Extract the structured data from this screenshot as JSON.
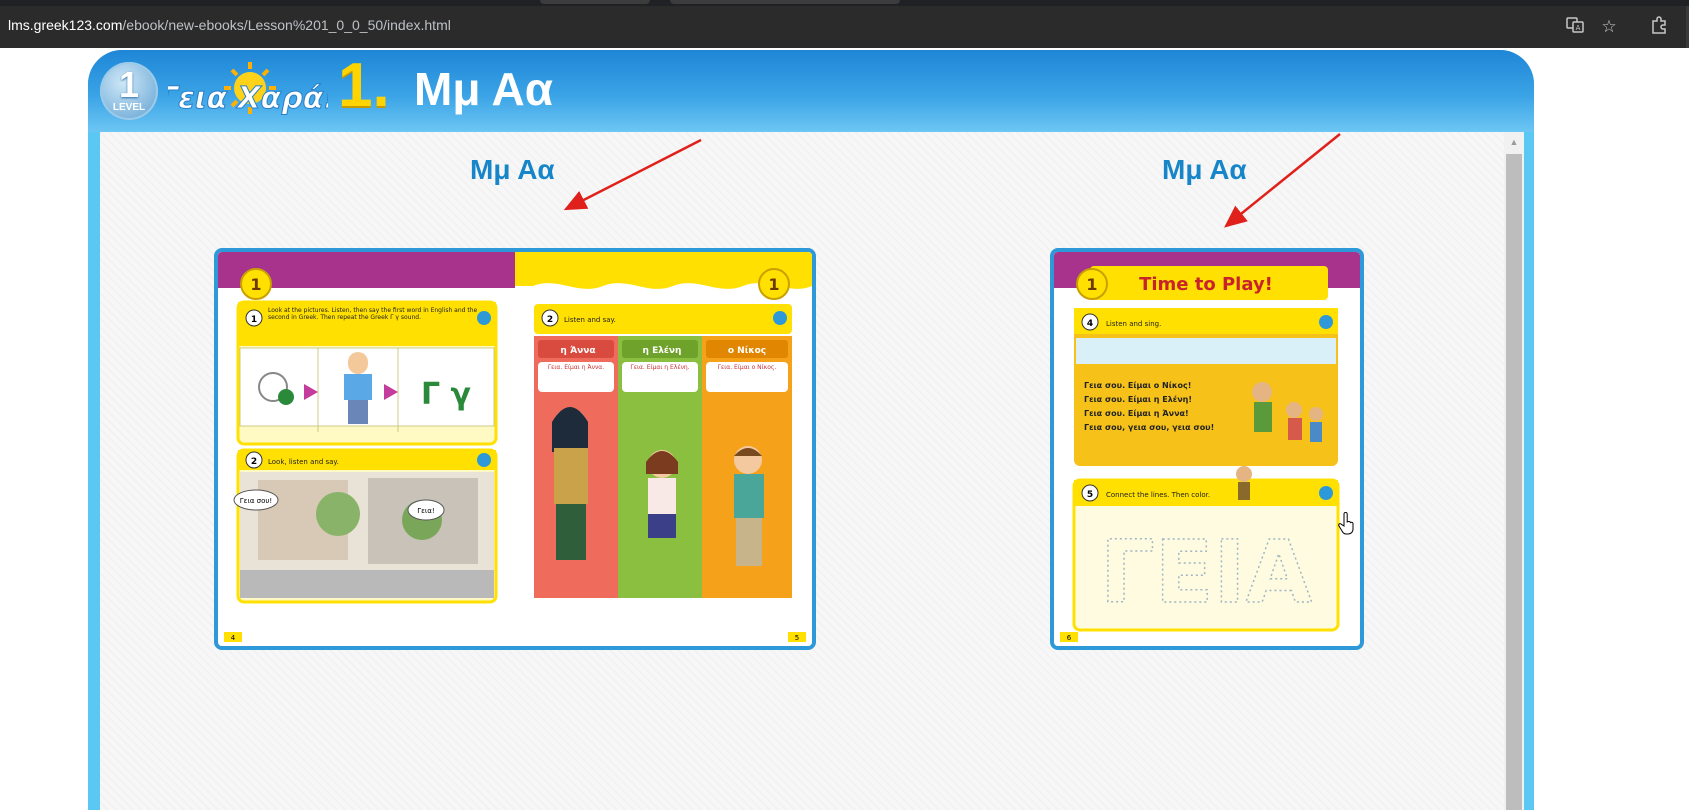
{
  "browser": {
    "url_host": "lms.greek123.com",
    "url_path": "/ebook/new-ebooks/Lesson%201_0_0_50/index.html",
    "icons": [
      "translate-icon",
      "bookmark-star-icon",
      "extensions-icon"
    ]
  },
  "header": {
    "level_number": "1",
    "level_label": "LEVEL",
    "logo_text": "Γεια Χαρά!",
    "lesson_number": "1.",
    "lesson_title": "Μμ Αα"
  },
  "pages": [
    {
      "title": "Μμ Αα",
      "left_page": {
        "lesson_badge": "1",
        "task1": "Look at the pictures. Listen, then say the first word in English and the second in Greek. Then repeat the Greek Γ γ sound.",
        "big_letters": "Γ γ",
        "task2": "Look, listen and say.",
        "bubble_left": "Γεια σου!",
        "bubble_right": "Γεια!",
        "page_no": "4"
      },
      "right_page": {
        "lesson_badge": "1",
        "task": "Listen and say.",
        "names": [
          "η Άννα",
          "η Ελένη",
          "ο Νίκος"
        ],
        "greetings": [
          "Γεια. Είμαι η Άννα.",
          "Γεια. Είμαι η Ελένη.",
          "Γεια. Είμαι ο Νίκος."
        ],
        "page_no": "5"
      }
    },
    {
      "title": "Μμ Αα",
      "single_page": {
        "lesson_badge": "1",
        "banner": "Time to Play!",
        "task4": "Listen and sing.",
        "song_lines": [
          "Γεια σου. Είμαι ο Νίκος!",
          "Γεια σου. Είμαι η Ελένη!",
          "Γεια σου. Είμαι η Άννα!",
          "Γεια σου, γεια σου, γεια σου!"
        ],
        "task5": "Connect the lines. Then color.",
        "trace_word": "ΓΕΙΑ",
        "page_no": "6"
      }
    }
  ],
  "colors": {
    "header_blue": "#1e86d6",
    "frame_light_blue": "#5ac8f2",
    "title_blue": "#1686c9",
    "lesson_yellow": "#ffd400",
    "annotation_red": "#e0201b"
  }
}
